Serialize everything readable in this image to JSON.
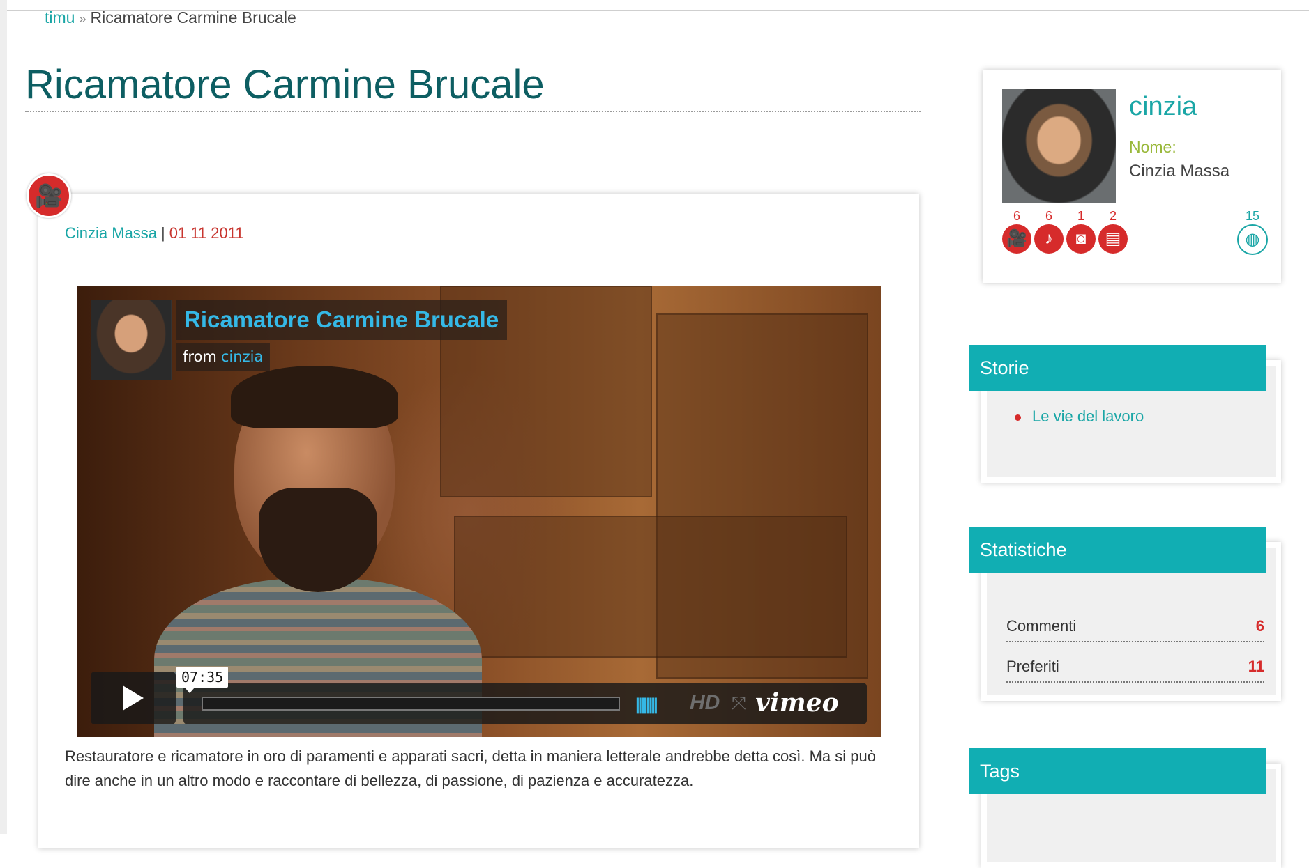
{
  "breadcrumb": {
    "home": "timu",
    "separator": "»",
    "current": "Ricamatore Carmine Brucale"
  },
  "page_title": "Ricamatore Carmine Brucale",
  "post": {
    "author": "Cinzia Massa",
    "separator": "|",
    "date": "01 11 2011",
    "video": {
      "title": "Ricamatore Carmine Brucale",
      "from_label": "from",
      "from_user": "cinzia",
      "duration": "07:35",
      "hd_label": "HD",
      "brand": "vimeo"
    },
    "description": "Restauratore e ricamatore in oro di paramenti e apparati sacri, detta in maniera letterale andrebbe detta così. Ma si può dire anche in un altro modo e raccontare di bellezza, di passione, di pazienza e accuratezza."
  },
  "profile": {
    "username": "cinzia",
    "name_label": "Nome:",
    "name_value": "Cinzia Massa",
    "counts": [
      {
        "icon": "film-icon",
        "count": "6"
      },
      {
        "icon": "music-icon",
        "count": "6"
      },
      {
        "icon": "camera-icon",
        "count": "1"
      },
      {
        "icon": "document-icon",
        "count": "2"
      },
      {
        "icon": "globe-icon",
        "count": "15"
      }
    ]
  },
  "stories": {
    "title": "Storie",
    "items": [
      "Le vie del lavoro"
    ]
  },
  "stats": {
    "title": "Statistiche",
    "rows": [
      {
        "label": "Commenti",
        "value": "6"
      },
      {
        "label": "Preferiti",
        "value": "11"
      }
    ]
  },
  "tags": {
    "title": "Tags"
  },
  "colors": {
    "accent": "#11aeb3",
    "red": "#d62b2b",
    "title": "#0d5e62"
  }
}
